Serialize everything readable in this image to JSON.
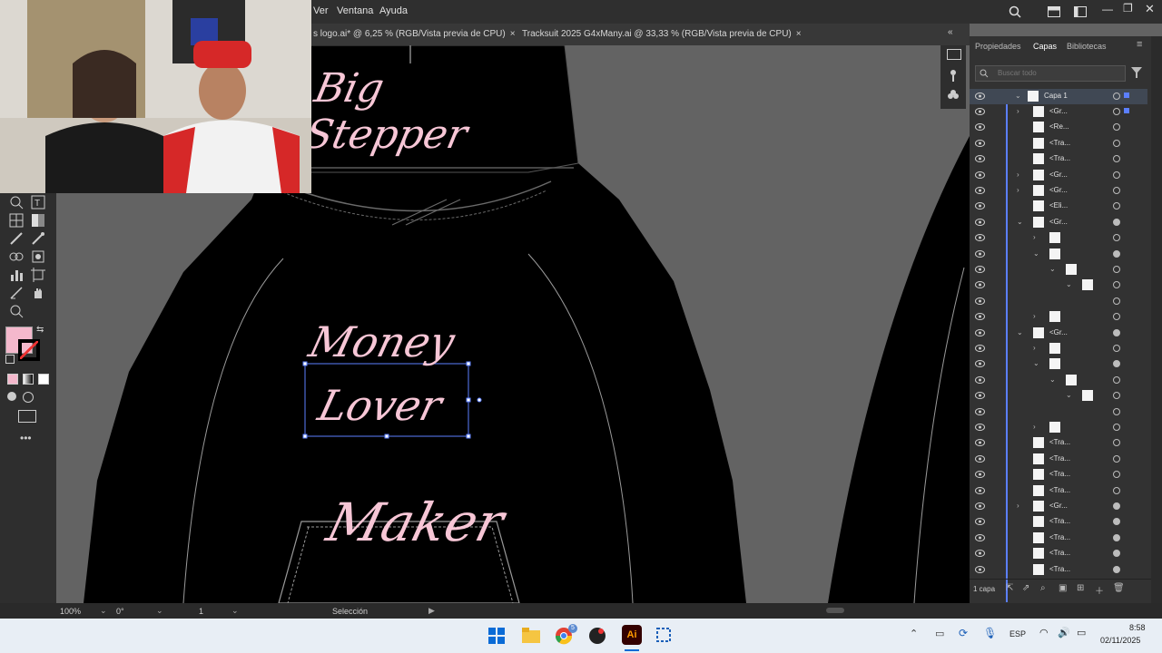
{
  "menubar": {
    "menus": [
      "Ver",
      "Ventana",
      "Ayuda"
    ]
  },
  "tabs": [
    {
      "label": "s logo.ai* @ 6,25 % (RGB/Vista previa de CPU)",
      "close": "×"
    },
    {
      "label": "Tracksuit 2025 G4xMany.ai @ 33,33 % (RGB/Vista previa de CPU)",
      "close": "×"
    }
  ],
  "artwork": {
    "hood_text": "Big Stepper",
    "chest_text_1": "Money",
    "chest_text_2": "Lover",
    "pocket_text": "Maker"
  },
  "panel": {
    "tabs": [
      "Propiedades",
      "Capas",
      "Bibliotecas"
    ],
    "active_tab": "Capas",
    "search_placeholder": "Buscar todo",
    "top_layer": "Capa 1",
    "layer_names": [
      "<Gr...",
      "<Re...",
      "<Tra...",
      "<Tra...",
      "<Gr...",
      "<Gr...",
      "<Eli...",
      "<Gr...",
      "",
      "",
      "",
      "",
      "",
      "",
      "<Gr...",
      "",
      "",
      "",
      "",
      "",
      "",
      "<Tra...",
      "<Tra...",
      "<Tra...",
      "<Tra...",
      "<Gr...",
      "<Tra...",
      "<Tra...",
      "<Tra...",
      "<Tra..."
    ],
    "footer_count": "1 capa"
  },
  "statusbar": {
    "zoom": "100%",
    "rotation": "0°",
    "artboard": "1",
    "tool": "Selección"
  },
  "taskbar": {
    "lang": "ESP",
    "time": "8:58",
    "date": "02/11/2025",
    "chrome_badge": "5"
  },
  "colors": {
    "fill": "#f4b8cc",
    "accent_text": "#f7c6d6",
    "hoodie": "#000000",
    "selection": "#5b7fff"
  },
  "icons": [
    "search-icon",
    "minimize-icon",
    "maximize-icon",
    "close-icon",
    "eye-icon",
    "chevron-icon",
    "filter-icon",
    "windows-icon",
    "file-explorer-icon",
    "chrome-icon",
    "illustrator-icon",
    "wifi-icon",
    "volume-icon",
    "battery-icon"
  ]
}
